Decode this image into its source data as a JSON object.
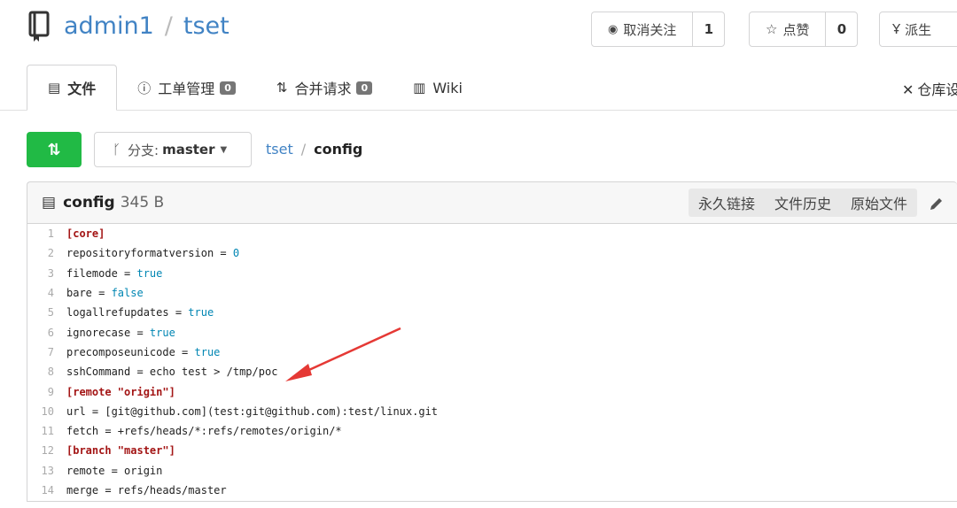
{
  "repo": {
    "owner": "admin1",
    "name": "tset"
  },
  "actions": {
    "watch_label": "取消关注",
    "watch_count": "1",
    "star_label": "点赞",
    "star_count": "0",
    "fork_label": "派生"
  },
  "tabs": [
    {
      "label": "文件",
      "icon": "file-icon"
    },
    {
      "label": "工单管理",
      "badge": "0",
      "icon": "issue-icon"
    },
    {
      "label": "合并请求",
      "badge": "0",
      "icon": "pull-request-icon"
    },
    {
      "label": "Wiki",
      "icon": "book-icon"
    }
  ],
  "settings_label": "仓库设",
  "branch": {
    "prefix": "分支:",
    "name": "master"
  },
  "breadcrumb": {
    "repo": "tset",
    "file": "config"
  },
  "file": {
    "name": "config",
    "size": "345 B",
    "buttons": [
      "永久链接",
      "文件历史",
      "原始文件"
    ]
  },
  "code_lines": [
    {
      "n": "1",
      "text": "[core]"
    },
    {
      "n": "2",
      "text": "repositoryformatversion = 0"
    },
    {
      "n": "3",
      "text": "filemode = true"
    },
    {
      "n": "4",
      "text": "bare = false"
    },
    {
      "n": "5",
      "text": "logallrefupdates = true"
    },
    {
      "n": "6",
      "text": "ignorecase = true"
    },
    {
      "n": "7",
      "text": "precomposeunicode = true"
    },
    {
      "n": "8",
      "text": "sshCommand = echo test > /tmp/poc"
    },
    {
      "n": "9",
      "text": "[remote \"origin\"]"
    },
    {
      "n": "10",
      "text": "url = [git@github.com](test:git@github.com):test/linux.git"
    },
    {
      "n": "11",
      "text": "fetch = +refs/heads/*:refs/remotes/origin/*"
    },
    {
      "n": "12",
      "text": "[branch \"master\"]"
    },
    {
      "n": "13",
      "text": "remote = origin"
    },
    {
      "n": "14",
      "text": "merge = refs/heads/master"
    }
  ],
  "colors": {
    "link": "#4183c4",
    "green": "#21ba45",
    "annotation_arrow": "#e53935"
  }
}
